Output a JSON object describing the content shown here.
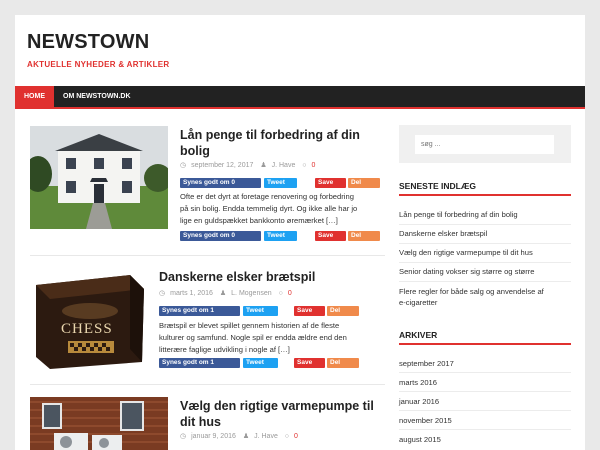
{
  "site": {
    "title": "NEWSTOWN",
    "tagline": "AKTUELLE NYHEDER & ARTIKLER"
  },
  "nav": {
    "items": [
      {
        "label": "HOME",
        "active": true
      },
      {
        "label": "OM NEWSTOWN.DK",
        "active": false
      }
    ]
  },
  "colors": {
    "accent": "#e0312f",
    "nav_bg": "#222222",
    "facebook": "#3b5998",
    "twitter": "#1da1f2",
    "delicious": "#f08a4b"
  },
  "posts": [
    {
      "title_line1": "Lån penge til forbedring af din",
      "title_line2": "bolig",
      "date": "september 12, 2017",
      "author": "J. Have",
      "comments": "0",
      "excerpt_lines": [
        "Ofte er det dyrt at foretage renovering og forbedring",
        "på sin bolig. Endda temmelig dyrt. Og ikke alle har jo",
        "lige en guldspækket bankkonto øremærket […]"
      ],
      "share": {
        "fb": "Synes godt om 0",
        "tw": "Tweet",
        "pin": "Save",
        "del": "Del"
      }
    },
    {
      "title_line1": "Danskerne elsker brætspil",
      "title_line2": "",
      "date": "marts 1, 2016",
      "author": "L. Mogensen",
      "comments": "0",
      "excerpt_lines": [
        "Brætspil er blevet spillet gennem historien af de fleste",
        "kulturer og samfund. Nogle spil er endda ældre end den",
        "litterære faglige udvikling i nogle af […]"
      ],
      "share": {
        "fb": "Synes godt om 1",
        "tw": "Tweet",
        "pin": "Save",
        "del": "Del"
      }
    },
    {
      "title_line1": "Vælg den rigtige varmepumpe til",
      "title_line2": "dit hus",
      "date": "januar 9, 2016",
      "author": "J. Have",
      "comments": "0"
    }
  ],
  "chess_box_text": "CHESS",
  "sidebar": {
    "search_placeholder": "søg ...",
    "recent_title": "SENESTE INDLÆG",
    "recent": [
      "Lån penge til forbedring af din bolig",
      "Danskerne elsker brætspil",
      "Vælg den rigtige varmepumpe til dit hus",
      "Senior dating vokser sig større og større",
      "Flere regler for både salg og anvendelse af",
      "e-cigaretter"
    ],
    "archive_title": "ARKIVER",
    "archive": [
      "september 2017",
      "marts 2016",
      "januar 2016",
      "november 2015",
      "august 2015"
    ]
  }
}
